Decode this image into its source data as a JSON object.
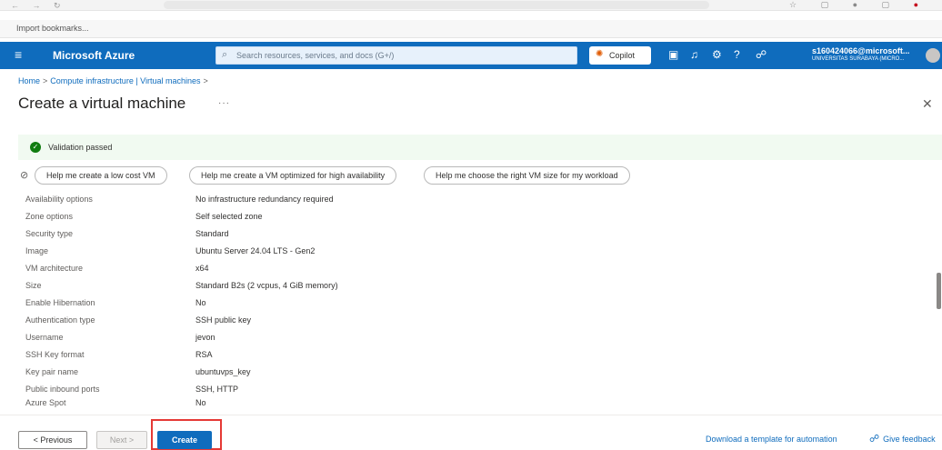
{
  "browser": {
    "bookmarks_label": "Import bookmarks..."
  },
  "header": {
    "brand": "Microsoft Azure",
    "search_placeholder": "Search resources, services, and docs (G+/)",
    "copilot_label": "Copilot",
    "account_name": "s160424066@microsoft...",
    "account_org": "UNIVERSITAS SURABAYA (MICRO..."
  },
  "breadcrumb": [
    "Home",
    "Compute infrastructure | Virtual machines"
  ],
  "page_title": "Create a virtual machine",
  "validation": {
    "text": "Validation passed"
  },
  "suggestions": [
    "Help me create a low cost VM",
    "Help me create a VM optimized for high availability",
    "Help me choose the right VM size for my workload"
  ],
  "details": [
    {
      "label": "Availability options",
      "value": "No infrastructure redundancy required"
    },
    {
      "label": "Zone options",
      "value": "Self selected zone"
    },
    {
      "label": "Security type",
      "value": "Standard"
    },
    {
      "label": "Image",
      "value": "Ubuntu Server 24.04 LTS - Gen2"
    },
    {
      "label": "VM architecture",
      "value": "x64"
    },
    {
      "label": "Size",
      "value": "Standard B2s (2 vcpus, 4 GiB memory)"
    },
    {
      "label": "Enable Hibernation",
      "value": "No"
    },
    {
      "label": "Authentication type",
      "value": "SSH public key"
    },
    {
      "label": "Username",
      "value": "jevon"
    },
    {
      "label": "SSH Key format",
      "value": "RSA"
    },
    {
      "label": "Key pair name",
      "value": "ubuntuvps_key"
    },
    {
      "label": "Public inbound ports",
      "value": "SSH, HTTP"
    },
    {
      "label": "Azure Spot",
      "value": "No"
    }
  ],
  "footer": {
    "previous_label": "< Previous",
    "next_label": "Next >",
    "create_label": "Create",
    "download_label": "Download a template for automation",
    "feedback_label": "Give feedback"
  },
  "colors": {
    "azure_blue": "#0f6cbd",
    "success_green": "#107c10",
    "highlight_red": "#e53935"
  }
}
